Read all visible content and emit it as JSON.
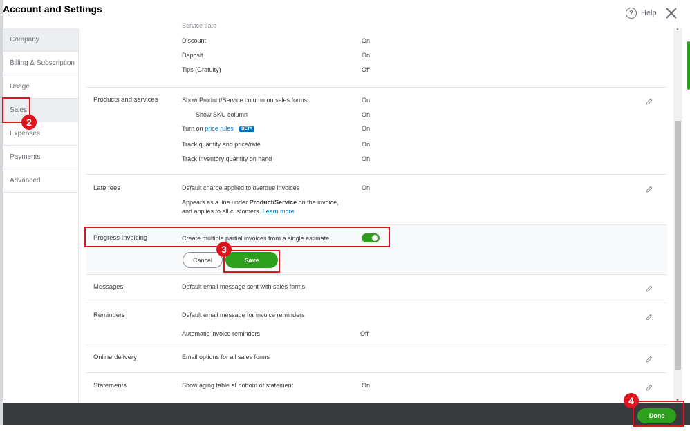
{
  "window": {
    "title": "Account and Settings",
    "help_label": "Help"
  },
  "sidebar": {
    "items": [
      {
        "label": "Company"
      },
      {
        "label": "Billing & Subscription"
      },
      {
        "label": "Usage"
      },
      {
        "label": "Sales"
      },
      {
        "label": "Expenses"
      },
      {
        "label": "Payments"
      },
      {
        "label": "Advanced"
      }
    ]
  },
  "sections": {
    "top_partial": {
      "cut_label": "Service date",
      "rows": [
        {
          "label": "Discount",
          "value": "On"
        },
        {
          "label": "Deposit",
          "value": "On"
        },
        {
          "label": "Tips (Gratuity)",
          "value": "Off"
        }
      ]
    },
    "products": {
      "label": "Products and services",
      "rows": [
        {
          "label": "Show Product/Service column on sales forms",
          "value": "On"
        },
        {
          "label": "Show SKU column",
          "value": "On"
        },
        {
          "label_prefix": "Turn on",
          "link": "price rules",
          "badge": "BETA",
          "value": "On"
        },
        {
          "label": "Track quantity and price/rate",
          "value": "On"
        },
        {
          "label": "Track inventory quantity on hand",
          "value": "On"
        }
      ]
    },
    "late_fees": {
      "label": "Late fees",
      "row_label": "Default charge applied to overdue invoices",
      "row_value": "On",
      "desc_prefix": "Appears as a line under",
      "desc_bold": "Product/Service",
      "desc_mid": "on the invoice,",
      "desc_line2": "and applies to all customers.",
      "learn_more": "Learn more"
    },
    "progress": {
      "label": "Progress Invoicing",
      "row_label": "Create multiple partial invoices from a single estimate",
      "toggle_on": true,
      "cancel_label": "Cancel",
      "save_label": "Save"
    },
    "messages": {
      "label": "Messages",
      "row_label": "Default email message sent with sales forms"
    },
    "reminders": {
      "label": "Reminders",
      "row1_label": "Default email message for invoice reminders",
      "row2_label": "Automatic invoice reminders",
      "row2_value": "Off"
    },
    "online_delivery": {
      "label": "Online delivery",
      "row_label": "Email options for all sales forms"
    },
    "statements": {
      "label": "Statements",
      "row_label": "Show aging table at bottom of statement",
      "row_value": "On"
    }
  },
  "footer": {
    "done_label": "Done"
  },
  "annotations": {
    "marker_2": "2",
    "marker_3": "3",
    "marker_4": "4"
  },
  "colors": {
    "accent_green": "#2ca01c",
    "link_blue": "#0077c5",
    "highlight_red": "#e0141e",
    "footer_dark": "#393a3d"
  }
}
